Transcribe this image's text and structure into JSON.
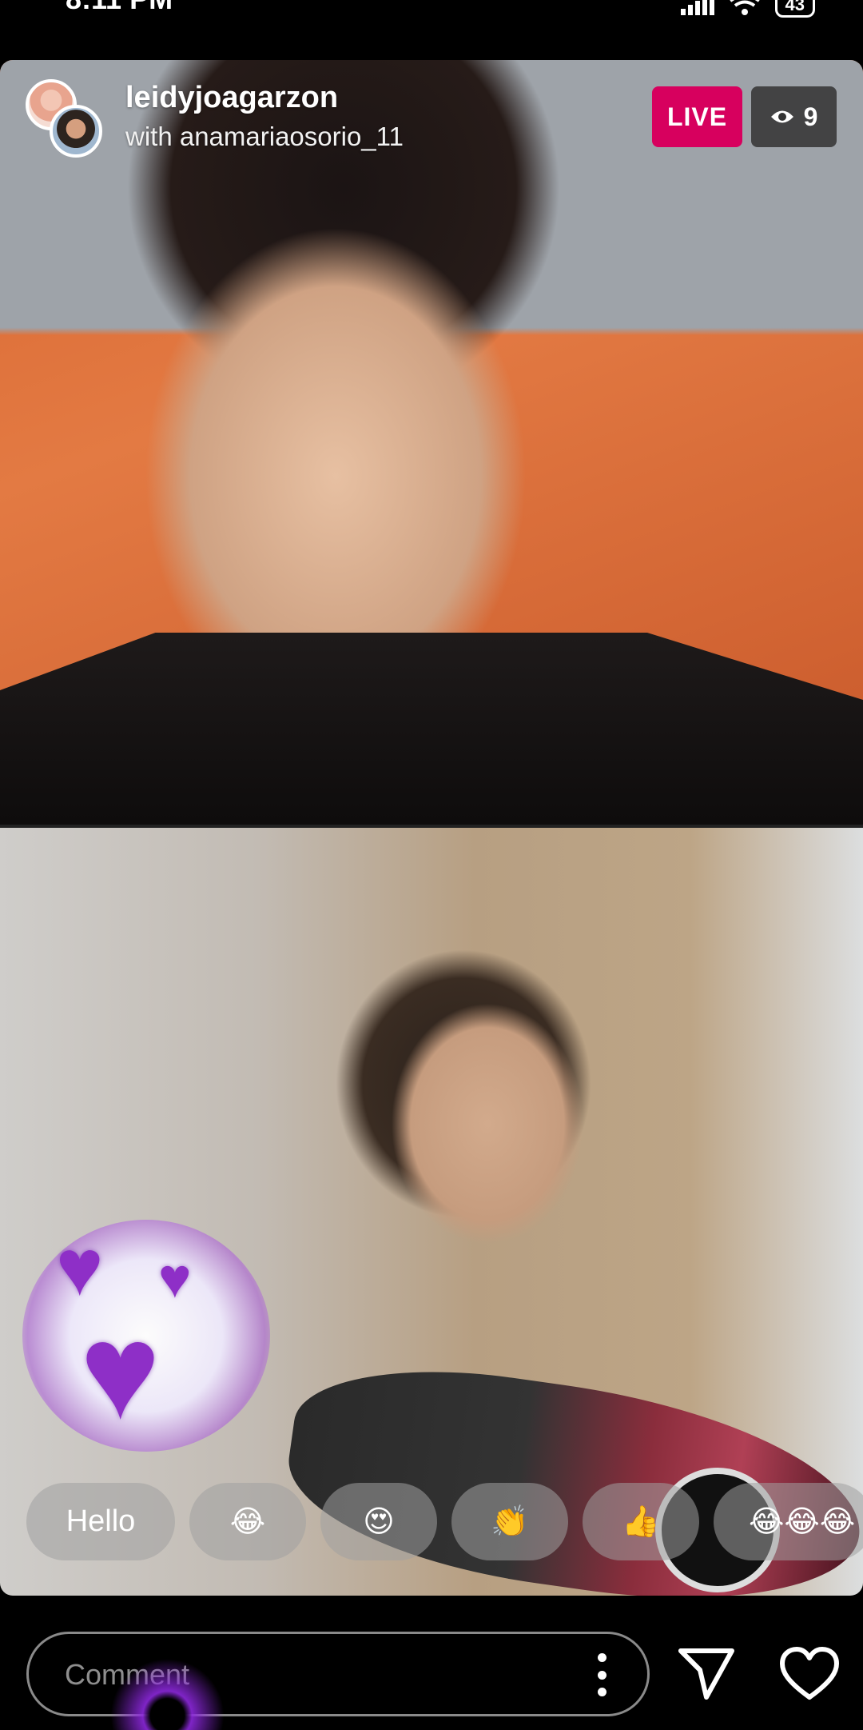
{
  "status_bar": {
    "time": "8:11 PM",
    "battery": "43"
  },
  "live": {
    "host_username": "leidyjoagarzon",
    "guest_line": "with anamariaosorio_11",
    "live_label": "LIVE",
    "viewer_count": "9"
  },
  "quick_reactions": [
    "Hello",
    "😂",
    "😍",
    "👏",
    "👍",
    "😂😂😂"
  ],
  "comment": {
    "placeholder": "Comment"
  },
  "icons": {
    "signal": "signal-icon",
    "wifi": "wifi-icon",
    "battery": "battery-icon",
    "viewers": "eye-icon",
    "send": "send-icon",
    "like": "heart-icon",
    "more": "more-vertical-icon"
  },
  "colors": {
    "live_badge": "#d7005e",
    "hearts": "#8e2fc7"
  }
}
